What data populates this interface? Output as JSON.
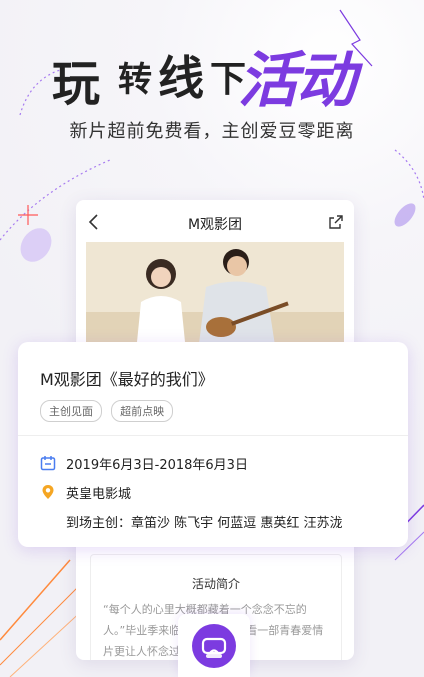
{
  "hero": {
    "title_parts": [
      "玩",
      "转",
      "线",
      "下",
      "活动"
    ],
    "subtitle": "新片超前免费看，主创爱豆零距离"
  },
  "phone": {
    "title": "M观影团",
    "intro": {
      "title": "活动简介",
      "text": "“每个人的心里大概都藏着一个念念不忘的人。”毕业季来临，还有什么比看一部青春爱情片更让人怀念过往的呢？"
    }
  },
  "card": {
    "title": "M观影团《最好的我们》",
    "tags": [
      "主创见面",
      "超前点映"
    ],
    "date": "2019年6月3日-2018年6月3日",
    "location": "英皇电影城",
    "guests": "到场主创：章笛沙 陈飞宇 何蓝逗 惠英红 汪苏泷"
  },
  "colors": {
    "accent": "#7c3be0",
    "calendar_icon": "#4a7df0",
    "location_icon": "#f5a623"
  },
  "icons": [
    "back-arrow-icon",
    "share-icon",
    "calendar-icon",
    "location-pin-icon",
    "vr-headset-icon"
  ]
}
